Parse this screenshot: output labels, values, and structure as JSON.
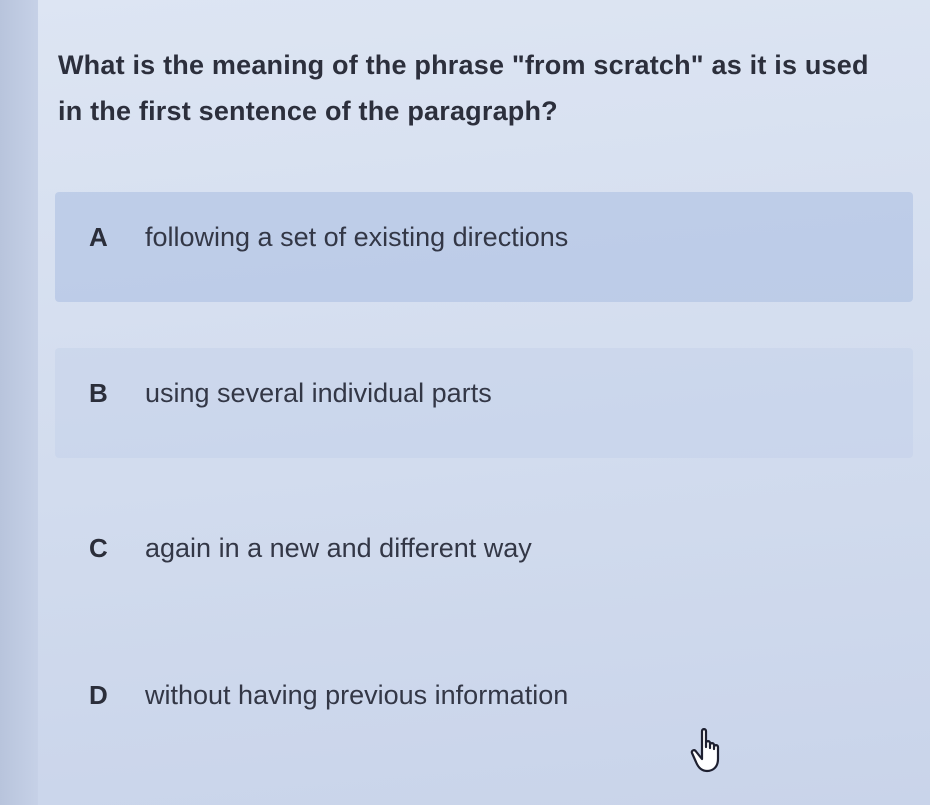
{
  "question": {
    "text": "What is the meaning of the phrase \"from scratch\" as it is used in the first sentence of the paragraph?"
  },
  "options": [
    {
      "letter": "A",
      "text": "following a set of existing directions"
    },
    {
      "letter": "B",
      "text": "using several individual parts"
    },
    {
      "letter": "C",
      "text": "again in a new and different way"
    },
    {
      "letter": "D",
      "text": "without having previous information"
    }
  ],
  "cursor": {
    "icon": "hand-pointer-icon"
  },
  "colors": {
    "background": "#d2dcee",
    "highlight": "#a0b6de",
    "text": "#2c2f3c"
  }
}
